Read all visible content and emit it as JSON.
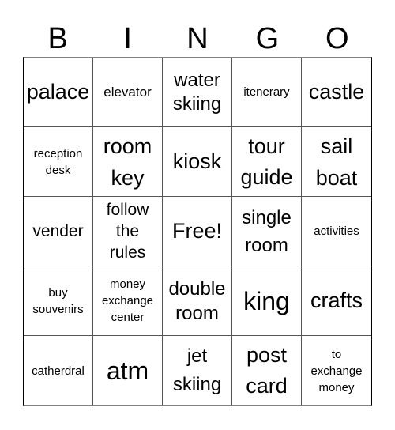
{
  "header": {
    "letters": [
      "B",
      "I",
      "N",
      "G",
      "O"
    ]
  },
  "cells": [
    "palace",
    "elevator",
    "water skiing",
    "itenerary",
    "castle",
    "reception desk",
    "room key",
    "kiosk",
    "tour guide",
    "sail boat",
    "vender",
    "follow the rules",
    "Free!",
    "single room",
    "activities",
    "buy souvenirs",
    "money exchange center",
    "double room",
    "king",
    "crafts",
    "catherdral",
    "atm",
    "jet skiing",
    "post card",
    "to exchange money"
  ]
}
